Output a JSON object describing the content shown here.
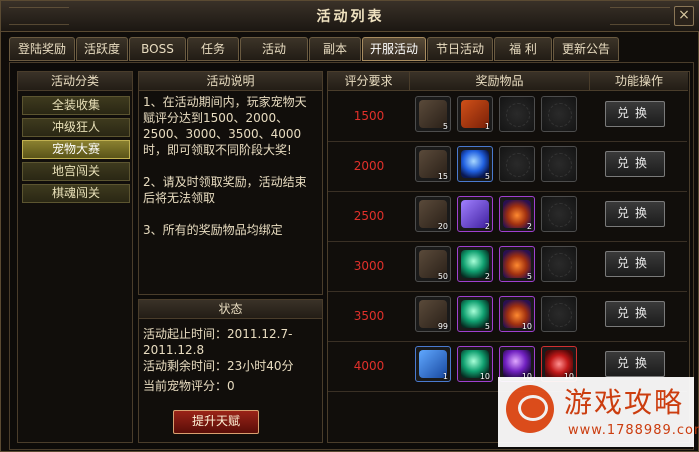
{
  "window": {
    "title": "活动列表",
    "close": "×"
  },
  "tabs": [
    {
      "label": "登陆奖励"
    },
    {
      "label": "活跃度"
    },
    {
      "label": "BOSS"
    },
    {
      "label": "任务"
    },
    {
      "label": "活动"
    },
    {
      "label": "副本"
    },
    {
      "label": "开服活动",
      "active": true
    },
    {
      "label": "节日活动"
    },
    {
      "label": "福  利"
    },
    {
      "label": "更新公告"
    }
  ],
  "categories": {
    "header": "活动分类",
    "items": [
      {
        "label": "全装收集"
      },
      {
        "label": "冲级狂人"
      },
      {
        "label": "宠物大赛",
        "active": true
      },
      {
        "label": "地宫闯关"
      },
      {
        "label": "棋魂闯关"
      }
    ]
  },
  "description": {
    "header": "活动说明",
    "p1": "1、在活动期间内，玩家宠物天赋评分达到1500、2000、2500、3000、3500、4000时，即可领取不同阶段大奖!",
    "p2": "2、请及时领取奖励，活动结束后将无法领取",
    "p3": "3、所有的奖励物品均绑定"
  },
  "status": {
    "header": "状态",
    "start_line1": "活动起止时间：2011.12.7-",
    "start_line2": "2011.12.8",
    "remaining": "活动剩余时间：23小时40分",
    "score": "当前宠物评分：0",
    "button": "提升天赋"
  },
  "table": {
    "headers": [
      "评分要求",
      "奖励物品",
      "功能操作"
    ],
    "rows": [
      {
        "score": "1500",
        "items": [
          {
            "icon": "scroll-icon",
            "count": "5",
            "style": "normal"
          },
          {
            "icon": "talisman-icon",
            "count": "1",
            "style": "orange"
          },
          {
            "icon": "empty-slot-icon",
            "count": "",
            "style": "empty"
          },
          {
            "icon": "empty-slot-icon",
            "count": "",
            "style": "empty"
          }
        ],
        "button": "兑换"
      },
      {
        "score": "2000",
        "items": [
          {
            "icon": "scroll-icon",
            "count": "15",
            "style": "normal"
          },
          {
            "icon": "blue-orb-icon",
            "count": "5",
            "style": "blue"
          },
          {
            "icon": "empty-slot-icon",
            "count": "",
            "style": "empty"
          },
          {
            "icon": "empty-slot-icon",
            "count": "",
            "style": "empty"
          }
        ],
        "button": "兑换"
      },
      {
        "score": "2500",
        "items": [
          {
            "icon": "scroll-icon",
            "count": "20",
            "style": "normal"
          },
          {
            "icon": "crystal-card-icon",
            "count": "2",
            "style": "purple"
          },
          {
            "icon": "gem-bag-icon",
            "count": "2",
            "style": "purple"
          },
          {
            "icon": "empty-slot-icon",
            "count": "",
            "style": "empty"
          }
        ],
        "button": "兑换"
      },
      {
        "score": "3000",
        "items": [
          {
            "icon": "scroll-icon",
            "count": "50",
            "style": "normal"
          },
          {
            "icon": "green-orb-icon",
            "count": "2",
            "style": "purple"
          },
          {
            "icon": "gem-bag-icon",
            "count": "5",
            "style": "purple"
          },
          {
            "icon": "empty-slot-icon",
            "count": "",
            "style": "empty"
          }
        ],
        "button": "兑换"
      },
      {
        "score": "3500",
        "items": [
          {
            "icon": "scroll-icon",
            "count": "99",
            "style": "normal"
          },
          {
            "icon": "green-orb-icon",
            "count": "5",
            "style": "purple"
          },
          {
            "icon": "gem-bag-icon",
            "count": "10",
            "style": "purple"
          },
          {
            "icon": "empty-slot-icon",
            "count": "",
            "style": "empty"
          }
        ],
        "button": "兑换"
      },
      {
        "score": "4000",
        "items": [
          {
            "icon": "fire-book-icon",
            "count": "1",
            "style": "blue"
          },
          {
            "icon": "green-orb-icon",
            "count": "10",
            "style": "purple"
          },
          {
            "icon": "purple-orb-icon",
            "count": "10",
            "style": "purple"
          },
          {
            "icon": "red-gem-icon",
            "count": "10",
            "style": "red"
          }
        ],
        "button": "兑换"
      }
    ]
  },
  "watermark": {
    "title": "游戏攻略",
    "url": "www.1788989.com"
  },
  "colors": {
    "score_red": "#e0302a",
    "category_active": "#8a8030",
    "accent_gold": "#a88c60"
  }
}
